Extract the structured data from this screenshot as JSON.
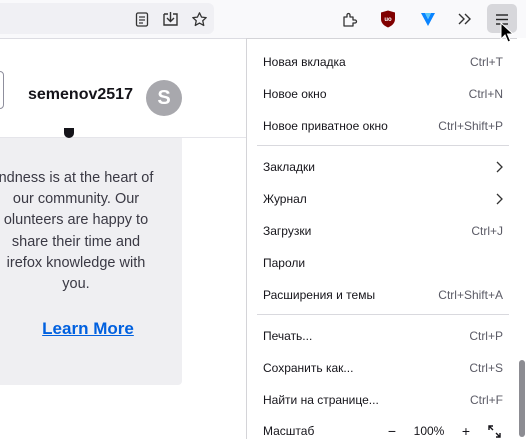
{
  "toolbar": {
    "icons": [
      "reader-view-icon",
      "save-to-pocket-icon",
      "bookmark-star-icon",
      "extensions-icon",
      "ublock-icon",
      "vpn-extension-icon",
      "overflow-chevron-icon",
      "hamburger-menu-icon"
    ],
    "colors": {
      "ublock": "#800000",
      "vpn": "#0a84ff"
    }
  },
  "page": {
    "username": "semenov2517",
    "avatar_letter": "S",
    "promo_text": "ndness is at the heart of\nour community. Our\nolunteers are happy to\nshare their time and\nirefox knowledge with\nyou.",
    "learn_more": "Learn More"
  },
  "menu": {
    "new_tab": {
      "label": "Новая вкладка",
      "shortcut": "Ctrl+T"
    },
    "new_window": {
      "label": "Новое окно",
      "shortcut": "Ctrl+N"
    },
    "new_private": {
      "label": "Новое приватное окно",
      "shortcut": "Ctrl+Shift+P"
    },
    "bookmarks": {
      "label": "Закладки"
    },
    "history": {
      "label": "Журнал"
    },
    "downloads": {
      "label": "Загрузки",
      "shortcut": "Ctrl+J"
    },
    "passwords": {
      "label": "Пароли"
    },
    "addons": {
      "label": "Расширения и темы",
      "shortcut": "Ctrl+Shift+A"
    },
    "print": {
      "label": "Печать...",
      "shortcut": "Ctrl+P"
    },
    "save_as": {
      "label": "Сохранить как...",
      "shortcut": "Ctrl+S"
    },
    "find": {
      "label": "Найти на странице...",
      "shortcut": "Ctrl+F"
    },
    "zoom": {
      "label": "Масштаб",
      "minus": "−",
      "value": "100%",
      "plus": "+"
    }
  }
}
